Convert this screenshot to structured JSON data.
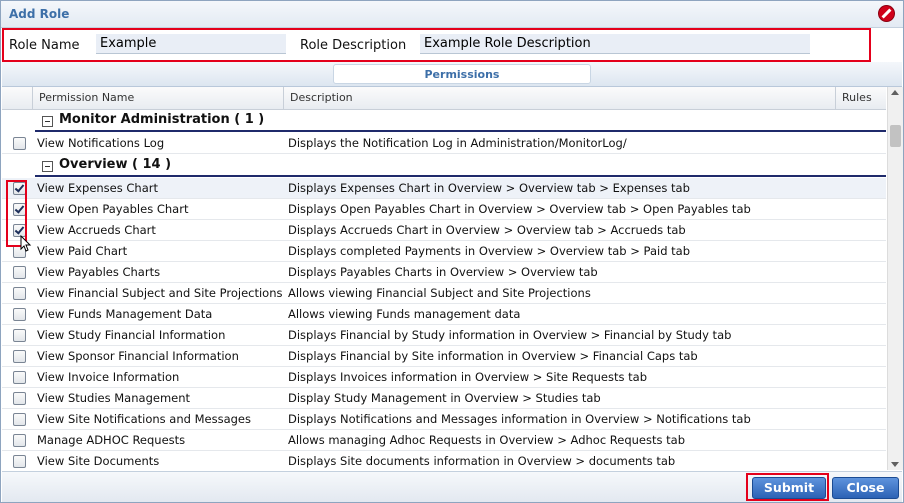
{
  "dialog": {
    "title": "Add Role"
  },
  "role_form": {
    "role_name_label": "Role Name",
    "role_name_value": "Example",
    "role_description_label": "Role Description",
    "role_description_value": "Example Role Description"
  },
  "tabs": {
    "permissions": "Permissions"
  },
  "grid": {
    "columns": {
      "permission_name": "Permission Name",
      "description": "Description",
      "rules": "Rules"
    },
    "groups": [
      {
        "name": "Monitor Administration ( 1 )",
        "rows": [
          {
            "name": "View Notifications Log",
            "description": "Displays the Notification Log in Administration/MonitorLog/",
            "checked": false
          }
        ]
      },
      {
        "name": "Overview ( 14 )",
        "rows": [
          {
            "name": "View Expenses Chart",
            "description": "Displays Expenses Chart in Overview > Overview tab > Expenses tab",
            "checked": true
          },
          {
            "name": "View Open Payables Chart",
            "description": "Displays Open Payables Chart in Overview > Overview tab > Open Payables tab",
            "checked": true
          },
          {
            "name": "View Accrueds Chart",
            "description": "Displays Accrueds Chart in Overview > Overview tab > Accrueds tab",
            "checked": true
          },
          {
            "name": "View Paid Chart",
            "description": "Displays completed Payments in Overview > Overview tab > Paid tab",
            "checked": false
          },
          {
            "name": "View Payables Charts",
            "description": "Displays Payables Charts in Overview > Overview tab",
            "checked": false
          },
          {
            "name": "View Financial Subject and Site Projections",
            "description": "Allows viewing Financial Subject and Site Projections",
            "checked": false
          },
          {
            "name": "View Funds Management Data",
            "description": "Allows viewing Funds management data",
            "checked": false
          },
          {
            "name": "View Study Financial Information",
            "description": "Displays Financial by Study information in Overview > Financial by Study tab",
            "checked": false
          },
          {
            "name": "View Sponsor Financial Information",
            "description": "Displays Financial by Site information in Overview > Financial Caps tab",
            "checked": false
          },
          {
            "name": "View Invoice Information",
            "description": "Displays Invoices information in Overview > Site Requests tab",
            "checked": false
          },
          {
            "name": "View Studies Management",
            "description": "Display Study Management in Overview > Studies tab",
            "checked": false
          },
          {
            "name": "View Site Notifications and Messages",
            "description": "Displays Notifications and Messages information in Overview > Notifications tab",
            "checked": false
          },
          {
            "name": "Manage ADHOC Requests",
            "description": "Allows managing Adhoc Requests in Overview > Adhoc Requests tab",
            "checked": false
          },
          {
            "name": "View Site Documents",
            "description": "Displays Site documents information in Overview > documents tab",
            "checked": false
          }
        ]
      }
    ]
  },
  "footer": {
    "submit_label": "Submit",
    "close_label": "Close"
  }
}
